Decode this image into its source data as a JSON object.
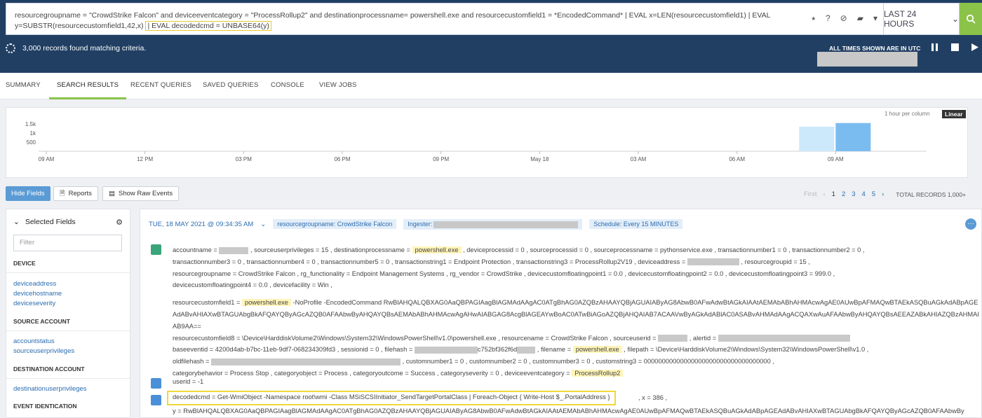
{
  "query": {
    "main": "resourcegroupname = \"CrowdStrike Falcon\" and deviceeventcategory = \"ProcessRollup2\"  and destinationprocessname= powershell.exe and resourcecustomfield1 = *EncodedCommand* | EVAL x=LEN(resourcecustomfield1) | EVAL y=SUBSTR(resourcecustomfield1,42,x)",
    "highlight": "| EVAL decodedcmd = UNBASE64(y)"
  },
  "time_range": "LAST 24 HOURS",
  "status": {
    "records": "3,000 records found matching criteria.",
    "utc": "ALL TIMES SHOWN ARE IN UTC"
  },
  "tabs": [
    "SUMMARY",
    "SEARCH RESULTS",
    "RECENT QUERIES",
    "SAVED QUERIES",
    "CONSOLE",
    "VIEW JOBS"
  ],
  "chart_data": {
    "type": "bar",
    "per_column": "1 hour per column",
    "scale": "Linear",
    "y_ticks": [
      "1.5k",
      "1k",
      "500"
    ],
    "x_ticks": [
      "09 AM",
      "12 PM",
      "03 PM",
      "06 PM",
      "09 PM",
      "May 18",
      "03 AM",
      "06 AM",
      "09 AM"
    ],
    "ylim": [
      0,
      2000
    ],
    "bars": [
      {
        "bin": "08 AM",
        "value": 1350,
        "color": "#cbe9fb"
      },
      {
        "bin": "09 AM",
        "value": 1550,
        "color": "#7bbcf0"
      }
    ]
  },
  "toolbar": {
    "hide_fields": "Hide Fields",
    "reports": "Reports",
    "raw": "Show Raw Events"
  },
  "pagination": {
    "first": "First",
    "pages": [
      "1",
      "2",
      "3",
      "4",
      "5"
    ],
    "total": "TOTAL RECORDS  1,000+"
  },
  "sidebar": {
    "title": "Selected Fields",
    "filter_placeholder": "Filter",
    "sections": [
      {
        "name": "DEVICE",
        "items": [
          "deviceaddress",
          "devicehostname",
          "deviceseverity"
        ]
      },
      {
        "name": "SOURCE ACCOUNT",
        "items": [
          "accountstatus",
          "sourceuserprivileges"
        ]
      },
      {
        "name": "DESTINATION ACCOUNT",
        "items": [
          "destinationuserprivileges"
        ]
      },
      {
        "name": "EVENT IDENTICATION",
        "items": []
      }
    ]
  },
  "event": {
    "timestamp": "TUE, 18 MAY 2021 @ 09:34:35 AM",
    "chip_group": "resourcegroupname: CrowdStrike Falcon",
    "chip_ingester": "Ingester:",
    "chip_schedule": "Schedule: Every 15 MINUTES",
    "r1": "accountname = ",
    "r1b": " ,  sourceuserprivileges = 15  ,  destinationprocessname = ",
    "r1c": "powershell.exe",
    "r1d": "  ,  deviceprocessid = 0  ,  sourceprocessid = 0  ,  sourceprocessname = pythonservice.exe  ,  transactionnumber1 = 0  ,  transactionnumber2 = 0  ,",
    "r2": "transactionnumber3 = 0  ,  transactionnumber4 = 0  ,  transactionnumber5 = 0  ,  transactionstring1 = Endpoint Protection  ,  transactionstring3 = ProcessRollup2V19  ,  deviceaddress = ",
    "r2b": "  ,  resourcegroupid = 15  ,",
    "r3": "resourcegroupname = CrowdStrike Falcon  ,  rg_functionality = Endpoint Management Systems  ,  rg_vendor = CrowdStrike  ,  devicecustomfloatingpoint1 = 0.0  ,  devicecustomfloatingpoint2 = 0.0  ,  devicecustomfloatingpoint3 = 999.0  ,",
    "r4": "devicecustomfloatingpoint4 = 0.0  ,  devicefacility = Win  ,",
    "r5a": "resourcecustomfield1 = ",
    "r5b": "powershell.exe",
    "r5c": " -NoProfile -EncodedCommand RwBlAHQALQBXAG0AaQBPAGIAagBlAGMAdAAgAC0ATgBhAG0AZQBzAHAAYQBjAGUAIAByAG8AbwB0AFwAdwBtAGkAIAAtAEMAbABhAHMAcwAgAE0AUwBpAFMAQwBTAEkASQBuAGkAdABpAGEAdABvAHIAXwBTAGUAbgBkAFQAYQByAGcAZQB0AFAAbwByAHQAYQBsAEMAbABhAHMAcwAgAHwAIABGAG8AcgBlAGEAYwBoAC0ATwBiAGoAZQBjAHQAIAB7ACAAVwByAGkAdABlAC0ASABvAHMAdAAgACQAXwAuAFAAbwByAHQAYQBsAEEAZABkAHIAZQBzAHMAIAB9AA==",
    "r6": "resourcecustomfield8 = \\Device\\HarddiskVolume2\\Windows\\System32\\WindowsPowerShell\\v1.0\\powershell.exe  ,  resourcename = CrowdStrike Falcon  ,  sourceuserid = ",
    "r6b": "  ,  alertid = ",
    "r7": "baseeventid = 4200d4ab-b7bc-11eb-9df7-068234309fd3  ,  sessionid = 0  ,  filehash = ",
    "r7b": "c752bf362f6d",
    "r7c": "  ,  filename = ",
    "r7d": "powershell.exe",
    "r7e": "  ,  filepath = \\Device\\HarddiskVolume2\\Windows\\System32\\WindowsPowerShell\\v1.0  ,",
    "r8": "oldfilehash = ",
    "r8b": "  ,  customnumber1 = 0  ,  customnumber2 = 0  ,  customnumber3 = 0  ,  customstring3 = 00000000000000000000000000000000000  ,",
    "r9": "categorybehavior = Process Stop  ,  categoryobject = Process  ,  categoryoutcome = Success  ,  categoryseverity = 0  ,  deviceeventcategory = ",
    "r9b": "ProcessRollup2",
    "userid": "userid = -1",
    "decoded_label": "decodedcmd",
    "decoded_value": " = Get-WmiObject -Namespace root\\wmi -Class MSiSCSIInitiator_SendTargetPortalClass | Foreach-Object { Write-Host $_.PortalAddress }",
    "x": ",  x = 386  ,",
    "y": "y = RwBlAHQALQBXAG0AaQBPAGIAagBlAGMAdAAgAC0ATgBhAG0AZQBzAHAAYQBjAGUAIAByAG8AbwB0AFwAdwBtAGkAIAAtAEMAbABhAHMAcwAgAE0AUwBpAFMAQwBTAEkASQBuAGkAdABpAGEAdABvAHIAXwBTAGUAbgBkAFQAYQByAGcAZQB0AFAAbwBy"
  },
  "colors": {
    "banner": "#213f63",
    "accent": "#8bc34a",
    "link": "#2b6cb0",
    "highlight": "#fff4b8"
  }
}
